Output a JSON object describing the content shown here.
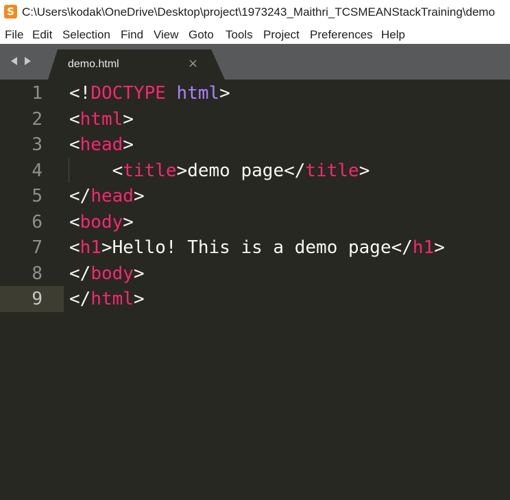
{
  "window": {
    "app_icon": "S",
    "title": "C:\\Users\\kodak\\OneDrive\\Desktop\\project\\1973243_Maithri_TCSMEANStackTraining\\demo"
  },
  "menu": [
    "File",
    "Edit",
    "Selection",
    "Find",
    "View",
    "Goto",
    "Tools",
    "Project",
    "Preferences",
    "Help"
  ],
  "tab": {
    "label": "demo.html",
    "close": "×"
  },
  "editor": {
    "current_line": 9,
    "lines": [
      {
        "n": "1",
        "parts": [
          {
            "t": "<!"
          },
          {
            "t": "DOCTYPE",
            "c": "tag"
          },
          {
            "t": " "
          },
          {
            "t": "html",
            "c": "kw"
          },
          {
            "t": ">"
          }
        ]
      },
      {
        "n": "2",
        "parts": [
          {
            "t": "<"
          },
          {
            "t": "html",
            "c": "tag"
          },
          {
            "t": ">"
          }
        ]
      },
      {
        "n": "3",
        "parts": [
          {
            "t": "<"
          },
          {
            "t": "head",
            "c": "tag"
          },
          {
            "t": ">"
          }
        ]
      },
      {
        "n": "4",
        "parts": [
          {
            "t": "    <"
          },
          {
            "t": "title",
            "c": "tag"
          },
          {
            "t": ">demo page</"
          },
          {
            "t": "title",
            "c": "tag"
          },
          {
            "t": ">"
          }
        ]
      },
      {
        "n": "5",
        "parts": [
          {
            "t": "</"
          },
          {
            "t": "head",
            "c": "tag"
          },
          {
            "t": ">"
          }
        ]
      },
      {
        "n": "6",
        "parts": [
          {
            "t": "<"
          },
          {
            "t": "body",
            "c": "tag"
          },
          {
            "t": ">"
          }
        ]
      },
      {
        "n": "7",
        "parts": [
          {
            "t": "<"
          },
          {
            "t": "h1",
            "c": "tag"
          },
          {
            "t": ">Hello! This is a demo page</"
          },
          {
            "t": "h1",
            "c": "tag"
          },
          {
            "t": ">"
          }
        ]
      },
      {
        "n": "8",
        "parts": [
          {
            "t": "</"
          },
          {
            "t": "body",
            "c": "tag"
          },
          {
            "t": ">"
          }
        ]
      },
      {
        "n": "9",
        "parts": [
          {
            "t": "</"
          },
          {
            "t": "html",
            "c": "tag"
          },
          {
            "t": ">"
          }
        ]
      }
    ]
  },
  "colors": {
    "background": "#272822",
    "tag": "#f92672",
    "keyword": "#ae81ff",
    "text": "#f8f8f2",
    "tabbar": "#58595b"
  }
}
